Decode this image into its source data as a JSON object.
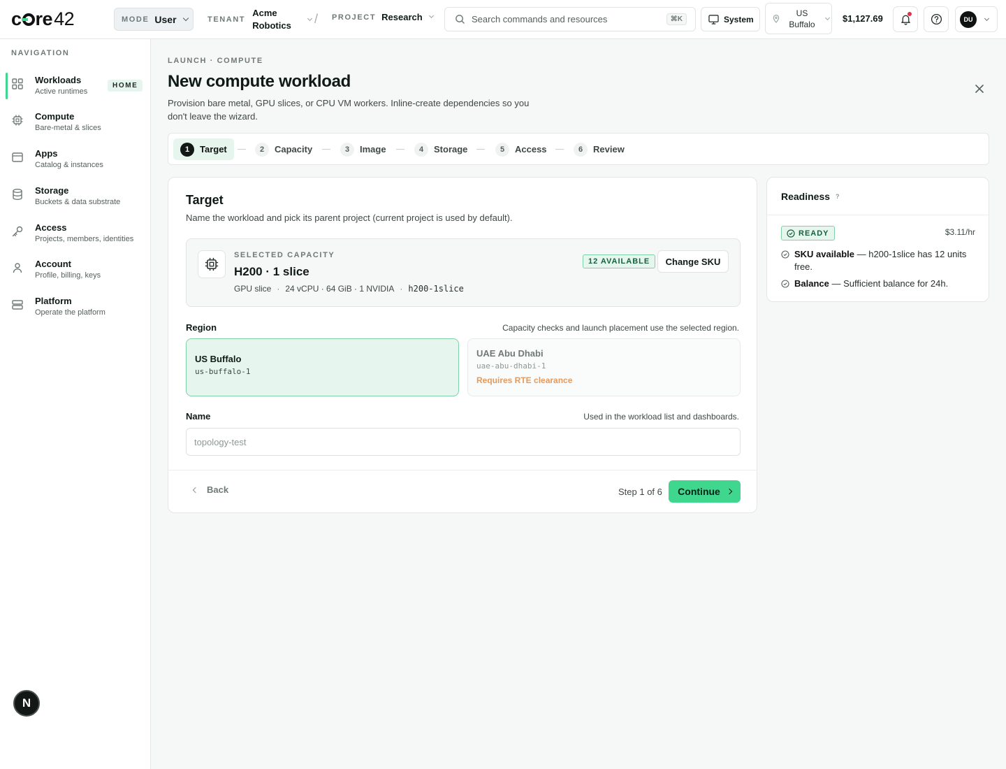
{
  "app": {
    "logo_a": "c",
    "logo_b": "re",
    "logo_num": "42"
  },
  "topbar": {
    "mode_label": "MODE",
    "mode_value": "User",
    "tenant_label": "TENANT",
    "tenant_value": "Acme Robotics",
    "separator": "/",
    "project_label": "PROJECT",
    "project_value": "Research",
    "search_placeholder": "Search commands and resources",
    "search_shortcut": "⌘K",
    "theme_label": "System",
    "region_label": "US Buffalo",
    "balance": "$1,127.69",
    "avatar_initials": "DU",
    "has_notification": true
  },
  "sidebar": {
    "title": "NAVIGATION",
    "items": [
      {
        "label": "Workloads",
        "sub": "Active runtimes",
        "icon": "grid-icon",
        "badge": "HOME",
        "active": true
      },
      {
        "label": "Compute",
        "sub": "Bare-metal & slices",
        "icon": "chip-icon"
      },
      {
        "label": "Apps",
        "sub": "Catalog & instances",
        "icon": "app-window-icon"
      },
      {
        "label": "Storage",
        "sub": "Buckets & data substrate",
        "icon": "database-icon"
      },
      {
        "label": "Access",
        "sub": "Projects, members, identities",
        "icon": "key-icon"
      },
      {
        "label": "Account",
        "sub": "Profile, billing, keys",
        "icon": "user-icon"
      },
      {
        "label": "Platform",
        "sub": "Operate the platform",
        "icon": "server-icon"
      }
    ],
    "bottom_button": "N"
  },
  "page": {
    "breadcrumb": "LAUNCH · COMPUTE",
    "title": "New compute workload",
    "description": "Provision bare metal, GPU slices, or CPU VM workers. Inline-create dependencies so you don't leave the wizard."
  },
  "stepper": {
    "steps": [
      {
        "num": "1",
        "label": "Target",
        "active": true
      },
      {
        "num": "2",
        "label": "Capacity"
      },
      {
        "num": "3",
        "label": "Image"
      },
      {
        "num": "4",
        "label": "Storage"
      },
      {
        "num": "5",
        "label": "Access"
      },
      {
        "num": "6",
        "label": "Review"
      }
    ]
  },
  "target": {
    "title": "Target",
    "subtitle": "Name the workload and pick its parent project (current project is used by default).",
    "capacity": {
      "label": "SELECTED CAPACITY",
      "name": "H200 · 1 slice",
      "type": "GPU slice",
      "specs": "24 vCPU · 64 GiB · 1 NVIDIA",
      "sku": "h200-1slice",
      "available": "12 AVAILABLE",
      "change_label": "Change SKU"
    },
    "region": {
      "label": "Region",
      "hint": "Capacity checks and launch placement use the selected region.",
      "options": [
        {
          "name": "US Buffalo",
          "code": "us-buffalo-1",
          "selected": true
        },
        {
          "name": "UAE Abu Dhabi",
          "code": "uae-abu-dhabi-1",
          "note": "Requires RTE clearance",
          "disabled": true
        }
      ]
    },
    "name": {
      "label": "Name",
      "hint": "Used in the workload list and dashboards.",
      "placeholder": "topology-test",
      "value": ""
    },
    "footer": {
      "back_label": "Back",
      "step_text": "Step 1 of 6",
      "continue_label": "Continue"
    }
  },
  "readiness": {
    "title": "Readiness",
    "help": "?",
    "status": "READY",
    "rate": "$3.11/hr",
    "checks": [
      {
        "label": "SKU available",
        "detail": " — h200-1slice has 12 units free."
      },
      {
        "label": "Balance",
        "detail": " — Sufficient balance for 24h."
      }
    ]
  },
  "colors": {
    "accent": "#3fd68e",
    "accent_soft": "#e6f6ee",
    "warning_text": "#e49a5e",
    "notification_dot": "#e0334b"
  }
}
